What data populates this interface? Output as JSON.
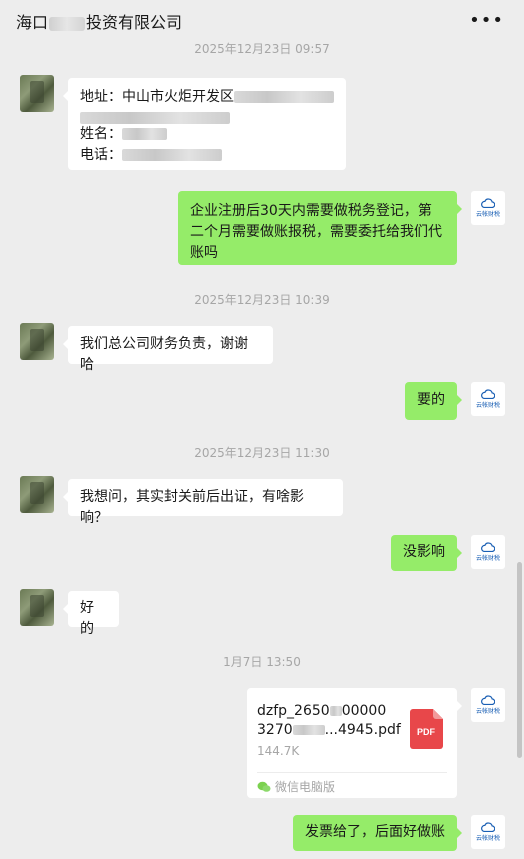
{
  "header": {
    "title_prefix": "海口",
    "title_suffix": "投资有限公司",
    "more_label": "•••"
  },
  "timestamps": {
    "t1": "2025年12月23日 09:57",
    "t2": "2025年12月23日 10:39",
    "t3": "2025年12月23日 11:30",
    "t4": "1月7日 13:50"
  },
  "messages": {
    "m1_address_label": "地址：",
    "m1_address_value": "中山市火炬开发区",
    "m1_name_label": "姓名：",
    "m1_phone_label": "电话：",
    "m2": "企业注册后30天内需要做税务登记，第二个月需要做账报税，需要委托给我们代账吗",
    "m3": "我们总公司财务负责，谢谢哈",
    "m4": "要的",
    "m5": "我想问，其实封关前后出证，有啥影响？",
    "m6": "没影响",
    "m7": "好的",
    "m9": "发票给了，后面好做账"
  },
  "file": {
    "name_line1": "dzfp_2650",
    "name_line1_tail": "00000",
    "name_line2": "3270",
    "name_line2_tail": "...4945.pdf",
    "size": "144.7K",
    "type_label": "PDF",
    "source": "微信电脑版"
  },
  "agent": {
    "brand": "云帐财税"
  },
  "colors": {
    "outgoing_bubble": "#95ec69",
    "incoming_bubble": "#ffffff",
    "background": "#ededed",
    "pdf_red": "#e8474a"
  }
}
